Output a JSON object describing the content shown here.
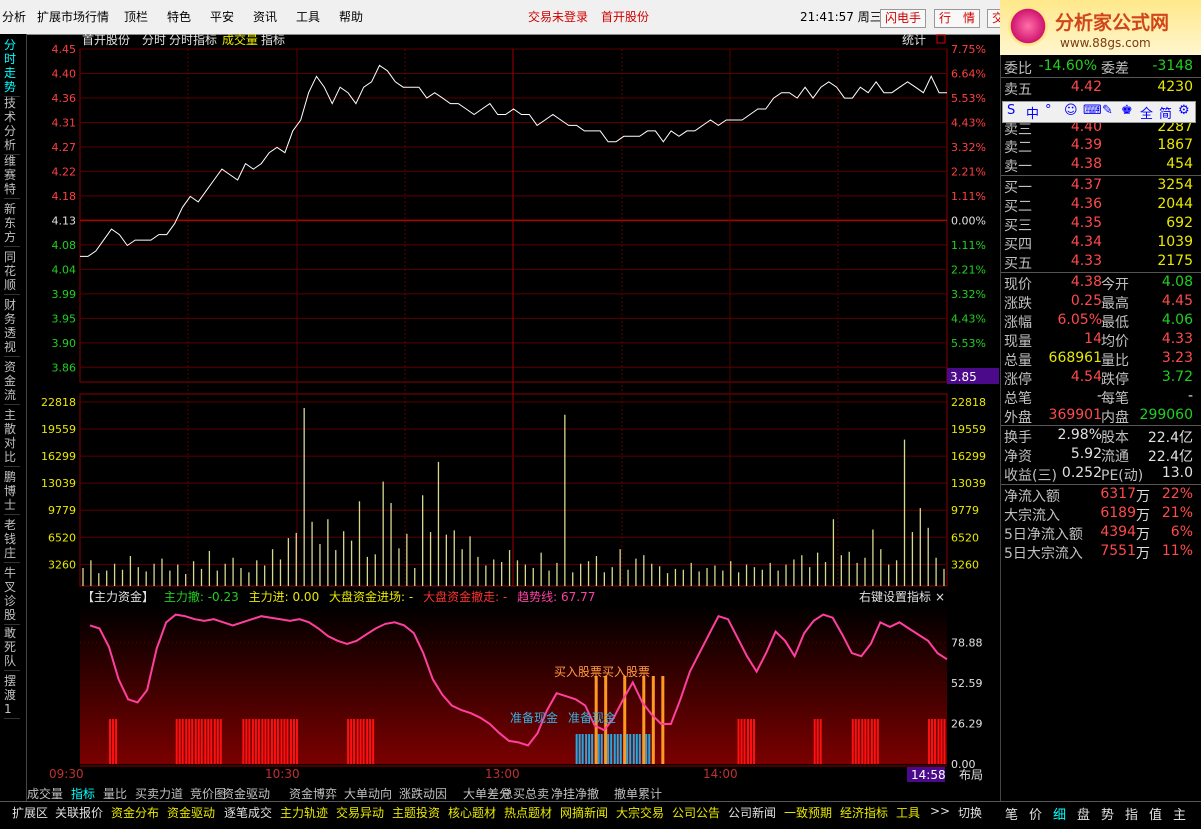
{
  "menu": {
    "items": [
      "分析",
      "扩展市场行情",
      "顶栏",
      "特色",
      "平安",
      "资讯",
      "工具",
      "帮助"
    ],
    "status1": "交易未登录",
    "status2": "首开股份",
    "clock": "21:41:57 周三",
    "btn_flash": "闪电手",
    "btn_quote": "行　情",
    "btn_trade": "交"
  },
  "logo": {
    "title": "分析家公式网",
    "url": "www.88gs.com"
  },
  "left_tabs": [
    "分时走势",
    "技术分析",
    "维赛特",
    "新东方",
    "同花顺",
    "财务透视",
    "资金流",
    "主散对比",
    "鹏博士",
    "老钱庄",
    "牛叉诊股",
    "敢死队",
    "摆渡1"
  ],
  "chart_header": {
    "stock": "首开股份",
    "items": [
      "分时",
      "分时指标",
      "成交量",
      "指标"
    ],
    "right": "统计"
  },
  "price_axis": {
    "left": [
      "4.45",
      "4.40",
      "4.36",
      "4.31",
      "4.27",
      "4.22",
      "4.18",
      "4.13",
      "4.08",
      "4.04",
      "3.99",
      "3.95",
      "3.90",
      "3.86"
    ],
    "right": [
      "7.75%",
      "6.64%",
      "5.53%",
      "4.43%",
      "3.32%",
      "2.21%",
      "1.11%",
      "0.00%",
      "1.11%",
      "2.21%",
      "3.32%",
      "4.43%",
      "5.53%"
    ],
    "cursor_price": "3.85"
  },
  "volume_axis": [
    "22818",
    "19559",
    "16299",
    "13039",
    "9779",
    "6520",
    "3260"
  ],
  "indicator": {
    "name": "【主力资金】",
    "label_out": "主力撤:",
    "val_out": "-0.23",
    "label_in": "主力进:",
    "val_in": "0.00",
    "label_big_in": "大盘资金进场:",
    "val_big_in": "-",
    "label_big_out": "大盘资金撤走:",
    "val_big_out": "-",
    "label_trend": "趋势线:",
    "val_trend": "67.77",
    "right": "右键设置指标",
    "close": "×",
    "axis": [
      "78.88",
      "52.59",
      "26.29",
      "0.00"
    ],
    "ann_buy": "买入股票买入股票",
    "ann_ready1": "准备现金",
    "ann_ready2": "准备现金"
  },
  "time_axis": {
    "labels": [
      "09:30",
      "10:30",
      "13:00",
      "14:00"
    ],
    "current": "14:58",
    "layout": "布局"
  },
  "chart_data": {
    "type": "line",
    "price": {
      "title": "首开股份",
      "base": 4.13,
      "ylim": [
        3.85,
        4.46
      ],
      "series": [
        4.08,
        4.08,
        4.09,
        4.11,
        4.13,
        4.12,
        4.1,
        4.11,
        4.11,
        4.11,
        4.12,
        4.12,
        4.14,
        4.17,
        4.19,
        4.18,
        4.2,
        4.22,
        4.24,
        4.23,
        4.22,
        4.25,
        4.24,
        4.25,
        4.27,
        4.28,
        4.27,
        4.31,
        4.33,
        4.38,
        4.41,
        4.39,
        4.36,
        4.39,
        4.38,
        4.36,
        4.39,
        4.4,
        4.43,
        4.42,
        4.4,
        4.39,
        4.39,
        4.39,
        4.37,
        4.38,
        4.37,
        4.36,
        4.36,
        4.35,
        4.34,
        4.35,
        4.36,
        4.34,
        4.34,
        4.35,
        4.34,
        4.34,
        4.32,
        4.33,
        4.34,
        4.33,
        4.32,
        4.32,
        4.31,
        4.31,
        4.31,
        4.29,
        4.29,
        4.3,
        4.3,
        4.3,
        4.31,
        4.31,
        4.29,
        4.31,
        4.3,
        4.31,
        4.31,
        4.32,
        4.33,
        4.32,
        4.33,
        4.33,
        4.33,
        4.34,
        4.35,
        4.35,
        4.37,
        4.38,
        4.38,
        4.37,
        4.39,
        4.37,
        4.39,
        4.4,
        4.39,
        4.37,
        4.37,
        4.39,
        4.38,
        4.4,
        4.38,
        4.38,
        4.39,
        4.4,
        4.39,
        4.38,
        4.41,
        4.38,
        4.38
      ],
      "current": 4.38
    },
    "volume": {
      "ylim": [
        0,
        25000
      ],
      "values": [
        2100,
        3000,
        1500,
        1800,
        2600,
        1900,
        3500,
        2200,
        1700,
        2600,
        3200,
        1800,
        2500,
        1400,
        2900,
        2000,
        4100,
        1800,
        2600,
        3300,
        2100,
        1600,
        3000,
        2400,
        4300,
        3100,
        5600,
        6200,
        20800,
        7500,
        4900,
        7800,
        4200,
        6400,
        5300,
        9900,
        3400,
        3700,
        12200,
        9700,
        4400,
        6100,
        2100,
        10600,
        6300,
        14500,
        6000,
        6500,
        4300,
        5800,
        3400,
        2400,
        3100,
        2800,
        4200,
        3000,
        2500,
        2100,
        3900,
        1800,
        2700,
        20000,
        1600,
        2600,
        2900,
        3500,
        1600,
        2200,
        4300,
        1900,
        3200,
        3600,
        2600,
        2300,
        1500,
        2000,
        1900,
        2700,
        1700,
        2100,
        2400,
        1800,
        2900,
        1600,
        2500,
        2200,
        1900,
        2700,
        1800,
        2500,
        3100,
        3600,
        2200,
        3900,
        2800,
        7800,
        3600,
        4000,
        2700,
        3300,
        6600,
        4300,
        2500,
        3000,
        17100,
        6300,
        9100,
        6800,
        3300,
        2000
      ]
    },
    "indicator": {
      "ylim": [
        0,
        100
      ],
      "trend": [
        90,
        88,
        76,
        55,
        42,
        40,
        48,
        75,
        92,
        97,
        96,
        94,
        93,
        94,
        92,
        90,
        92,
        94,
        96,
        95,
        94,
        93,
        94,
        92,
        88,
        83,
        80,
        78,
        80,
        84,
        88,
        91,
        92,
        90,
        85,
        72,
        55,
        45,
        38,
        35,
        33,
        30,
        26,
        20,
        15,
        14,
        12,
        20,
        35,
        46,
        44,
        42,
        38,
        25,
        22,
        30,
        42,
        53,
        40,
        32,
        26,
        26,
        42,
        60,
        72,
        84,
        96,
        94,
        82,
        70,
        60,
        72,
        86,
        80,
        70,
        85,
        93,
        97,
        95,
        84,
        72,
        70,
        78,
        92,
        89,
        92,
        88,
        84,
        80,
        72,
        68
      ],
      "histogram_red_ranges": [
        [
          2,
          2
        ],
        [
          9,
          13
        ],
        [
          16,
          21
        ],
        [
          27,
          29
        ],
        [
          68,
          69
        ],
        [
          76,
          76
        ],
        [
          80,
          82
        ],
        [
          88,
          89
        ]
      ],
      "histogram_cyan_range": [
        51,
        58
      ],
      "buy_bars": [
        53,
        54,
        56,
        58,
        59,
        60
      ]
    }
  },
  "quote": {
    "wb": {
      "label": "委比",
      "value": "-14.60%",
      "label2": "委差",
      "value2": "-3148"
    },
    "sell": [
      {
        "label": "卖五",
        "price": "4.42",
        "vol": "4230"
      },
      {
        "label": "卖三",
        "price": "4.40",
        "vol": "2287"
      },
      {
        "label": "卖二",
        "price": "4.39",
        "vol": "1867"
      },
      {
        "label": "卖一",
        "price": "4.38",
        "vol": "454"
      }
    ],
    "buy": [
      {
        "label": "买一",
        "price": "4.37",
        "vol": "3254"
      },
      {
        "label": "买二",
        "price": "4.36",
        "vol": "2044"
      },
      {
        "label": "买三",
        "price": "4.35",
        "vol": "692"
      },
      {
        "label": "买四",
        "price": "4.34",
        "vol": "1039"
      },
      {
        "label": "买五",
        "price": "4.33",
        "vol": "2175"
      }
    ],
    "stats": [
      {
        "l": "现价",
        "v": "4.38",
        "c1": "red",
        "l2": "今开",
        "v2": "4.08",
        "c2": "grn"
      },
      {
        "l": "涨跌",
        "v": "0.25",
        "c1": "red",
        "l2": "最高",
        "v2": "4.45",
        "c2": "red"
      },
      {
        "l": "涨幅",
        "v": "6.05%",
        "c1": "red",
        "l2": "最低",
        "v2": "4.06",
        "c2": "grn"
      },
      {
        "l": "现量",
        "v": "14",
        "c1": "red",
        "l2": "均价",
        "v2": "4.33",
        "c2": "red"
      },
      {
        "l": "总量",
        "v": "668961",
        "c1": "yel",
        "l2": "量比",
        "v2": "3.23",
        "c2": "red"
      },
      {
        "l": "涨停",
        "v": "4.54",
        "c1": "red",
        "l2": "跌停",
        "v2": "3.72",
        "c2": "grn"
      },
      {
        "l": "总笔",
        "v": "-",
        "c1": "wht",
        "l2": "每笔",
        "v2": "-",
        "c2": "wht"
      },
      {
        "l": "外盘",
        "v": "369901",
        "c1": "red",
        "l2": "内盘",
        "v2": "299060",
        "c2": "grn"
      }
    ],
    "stats2": [
      {
        "l": "换手",
        "v": "2.98%",
        "l2": "股本",
        "v2": "22.4亿"
      },
      {
        "l": "净资",
        "v": "5.92",
        "l2": "流通",
        "v2": "22.4亿"
      },
      {
        "l": "收益(三)",
        "v": "0.252",
        "l2": "PE(动)",
        "v2": "13.0"
      }
    ],
    "flows": [
      {
        "l": "净流入额",
        "v": "6317",
        "u": "万",
        "p": "22%"
      },
      {
        "l": "大宗流入",
        "v": "6189",
        "u": "万",
        "p": "21%"
      },
      {
        "l": "5日净流入额",
        "v": "4394",
        "u": "万",
        "p": "6%"
      },
      {
        "l": "5日大宗流入",
        "v": "7551",
        "u": "万",
        "p": "11%"
      }
    ]
  },
  "rtoolbar": {
    "items": [
      "S",
      "中",
      "°",
      "☺",
      "⌨",
      "✎",
      "♚",
      "全",
      "简",
      "⚙"
    ]
  },
  "tabs1": [
    "成交量",
    "指标",
    "量比",
    "买卖力道",
    "竞价图",
    "资金驱动",
    "资金博弈",
    "大单动向",
    "涨跌动因",
    "大单差分",
    "总买总卖",
    "净挂净撤",
    "撤单累计"
  ],
  "tabs2": [
    "扩展区",
    "关联报价",
    "资金分布",
    "资金驱动",
    "逐笔成交",
    "主力轨迹",
    "交易异动",
    "主题投资",
    "核心题材",
    "热点题材",
    "网摘新闻",
    "大宗交易",
    "公司公告",
    "公司新闻",
    "一致预期",
    "经济指标",
    "工具",
    ">>",
    "切换"
  ],
  "tabs3": [
    "笔",
    "价",
    "细",
    "盘",
    "势",
    "指",
    "值",
    "主"
  ]
}
